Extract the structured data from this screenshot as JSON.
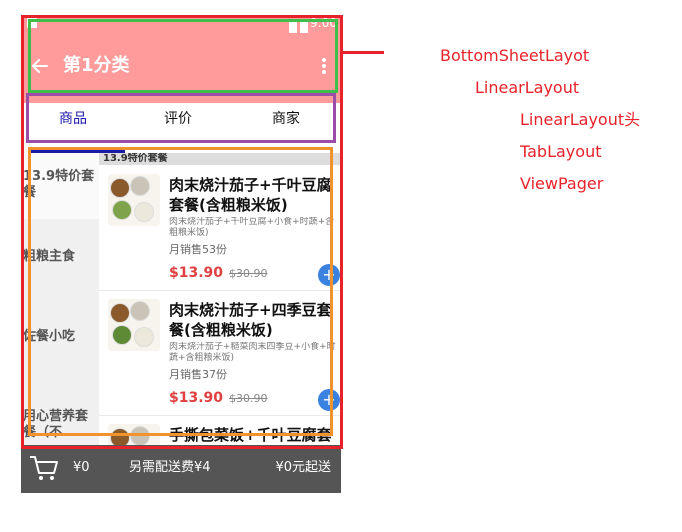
{
  "status_bar": {
    "time": "9:00"
  },
  "toolbar": {
    "title": "第1分类",
    "back_icon": "arrow-left-icon",
    "overflow_icon": "more-vert-icon"
  },
  "tabs": [
    "商品",
    "评价",
    "商家"
  ],
  "categories": [
    "13.9特价套餐",
    "粗粮主食",
    "佐餐小吃",
    "用心营养套餐（不"
  ],
  "section_header": "13.9特价套餐",
  "products": [
    {
      "name": "肉末烧汁茄子+千叶豆腐套餐(含粗粮米饭)",
      "name_line1": "肉末烧汁茄子+千叶豆腐",
      "name_line2": "套餐(含粗粮米饭)",
      "desc": "肉末烧汁茄子+千叶豆腐+小食+时蔬+含粗粮米饭)",
      "sales": "月销售53份",
      "price": "$13.90",
      "old_price": "$30.90"
    },
    {
      "name": "肉末烧汁茄子+四季豆套餐(含粗粮米饭)",
      "name_line1": "肉末烧汁茄子+四季豆套",
      "name_line2": "餐(含粗粮米饭)",
      "desc": "肉末烧汁茄子+糙菜肉末四季豆+小食+时蔬+含粗粮米饭)",
      "sales": "月销售37份",
      "price": "$13.90",
      "old_price": "$30.90"
    },
    {
      "name_line1": "手撕包菜饭+千叶豆腐套"
    }
  ],
  "bottom_bar": {
    "total": "¥0",
    "delivery": "另需配送费¥4",
    "min_order": "¥0元起送",
    "cart_icon": "shopping-cart-icon"
  },
  "annotations": {
    "bottom_sheet": "BottomSheetLayot",
    "linear_layout": "LinearLayout",
    "linear_layout_head": "LinearLayout头",
    "tab_layout": "TabLayout",
    "view_pager": "ViewPager"
  },
  "colors": {
    "toolbar": "#ff9b9b",
    "tab_active": "#1a1aa8",
    "price": "#e04040",
    "bottom_bar": "#555555",
    "annotation": "#e8222a"
  }
}
